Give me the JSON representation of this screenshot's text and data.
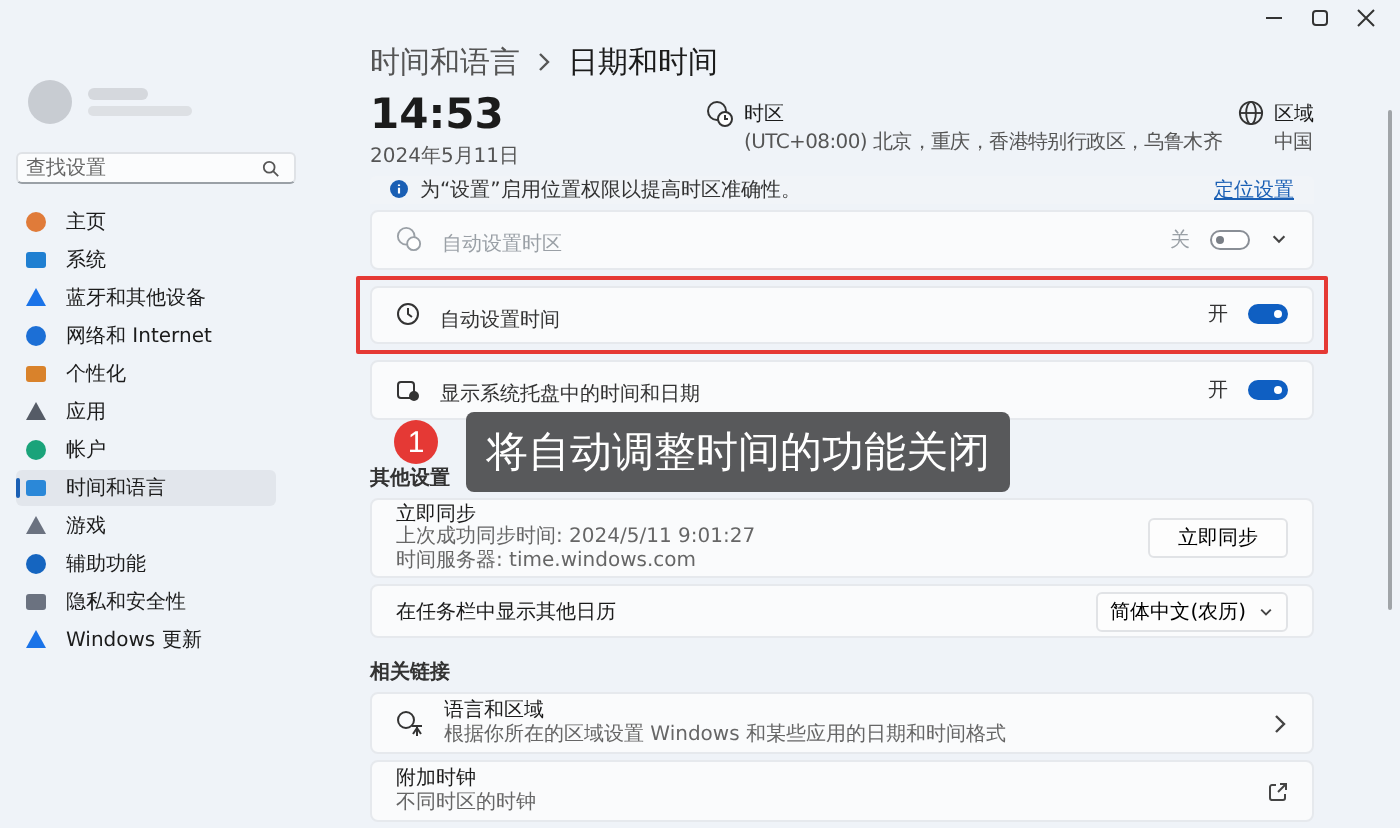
{
  "sidebar": {
    "search": {
      "placeholder": "查找设置"
    },
    "items": [
      {
        "label": "主页",
        "selected": false
      },
      {
        "label": "系统",
        "selected": false
      },
      {
        "label": "蓝牙和其他设备",
        "selected": false
      },
      {
        "label": "网络和 Internet",
        "selected": false
      },
      {
        "label": "个性化",
        "selected": false
      },
      {
        "label": "应用",
        "selected": false
      },
      {
        "label": "帐户",
        "selected": false
      },
      {
        "label": "时间和语言",
        "selected": true
      },
      {
        "label": "游戏",
        "selected": false
      },
      {
        "label": "辅助功能",
        "selected": false
      },
      {
        "label": "隐私和安全性",
        "selected": false
      },
      {
        "label": "Windows 更新",
        "selected": false
      }
    ]
  },
  "breadcrumb": {
    "parent": "时间和语言",
    "current": "日期和时间"
  },
  "clock": {
    "time": "14:53",
    "date": "2024年5月11日"
  },
  "time_zone": {
    "label": "时区",
    "value": "(UTC+08:00) 北京，重庆，香港特别行政区，乌鲁木齐"
  },
  "region": {
    "label": "区域",
    "value": "中国"
  },
  "banner": {
    "text": "为“设置”启用位置权限以提高时区准确性。",
    "link": "定位设置"
  },
  "main_settings": [
    {
      "label": "自动设置时区",
      "state_text": "关",
      "on": false,
      "disabled": true,
      "expandable": true,
      "highlighted": false
    },
    {
      "label": "自动设置时间",
      "state_text": "开",
      "on": true,
      "disabled": false,
      "expandable": false,
      "highlighted": true
    },
    {
      "label": "显示系统托盘中的时间和日期",
      "state_text": "开",
      "on": true,
      "disabled": false,
      "expandable": false,
      "highlighted": false
    }
  ],
  "other_settings": {
    "title": "其他设置",
    "rows": [
      {
        "kind": "sync",
        "title": "立即同步",
        "lines": [
          "上次成功同步时间: 2024/5/11 9:01:27",
          "时间服务器: time.windows.com"
        ],
        "button": "立即同步"
      },
      {
        "kind": "dropdown",
        "label": "在任务栏中显示其他日历",
        "value": "简体中文(农历)"
      }
    ]
  },
  "related_links": {
    "title": "相关链接",
    "rows": [
      {
        "kind": "navigate",
        "title": "语言和区域",
        "subtitle": "根据你所在的区域设置 Windows 和某些应用的日期和时间格式"
      },
      {
        "kind": "external",
        "title": "附加时钟",
        "subtitle": "不同时区的时钟"
      }
    ]
  },
  "annotation": {
    "number": "1",
    "text": "将自动调整时间的功能关闭"
  }
}
